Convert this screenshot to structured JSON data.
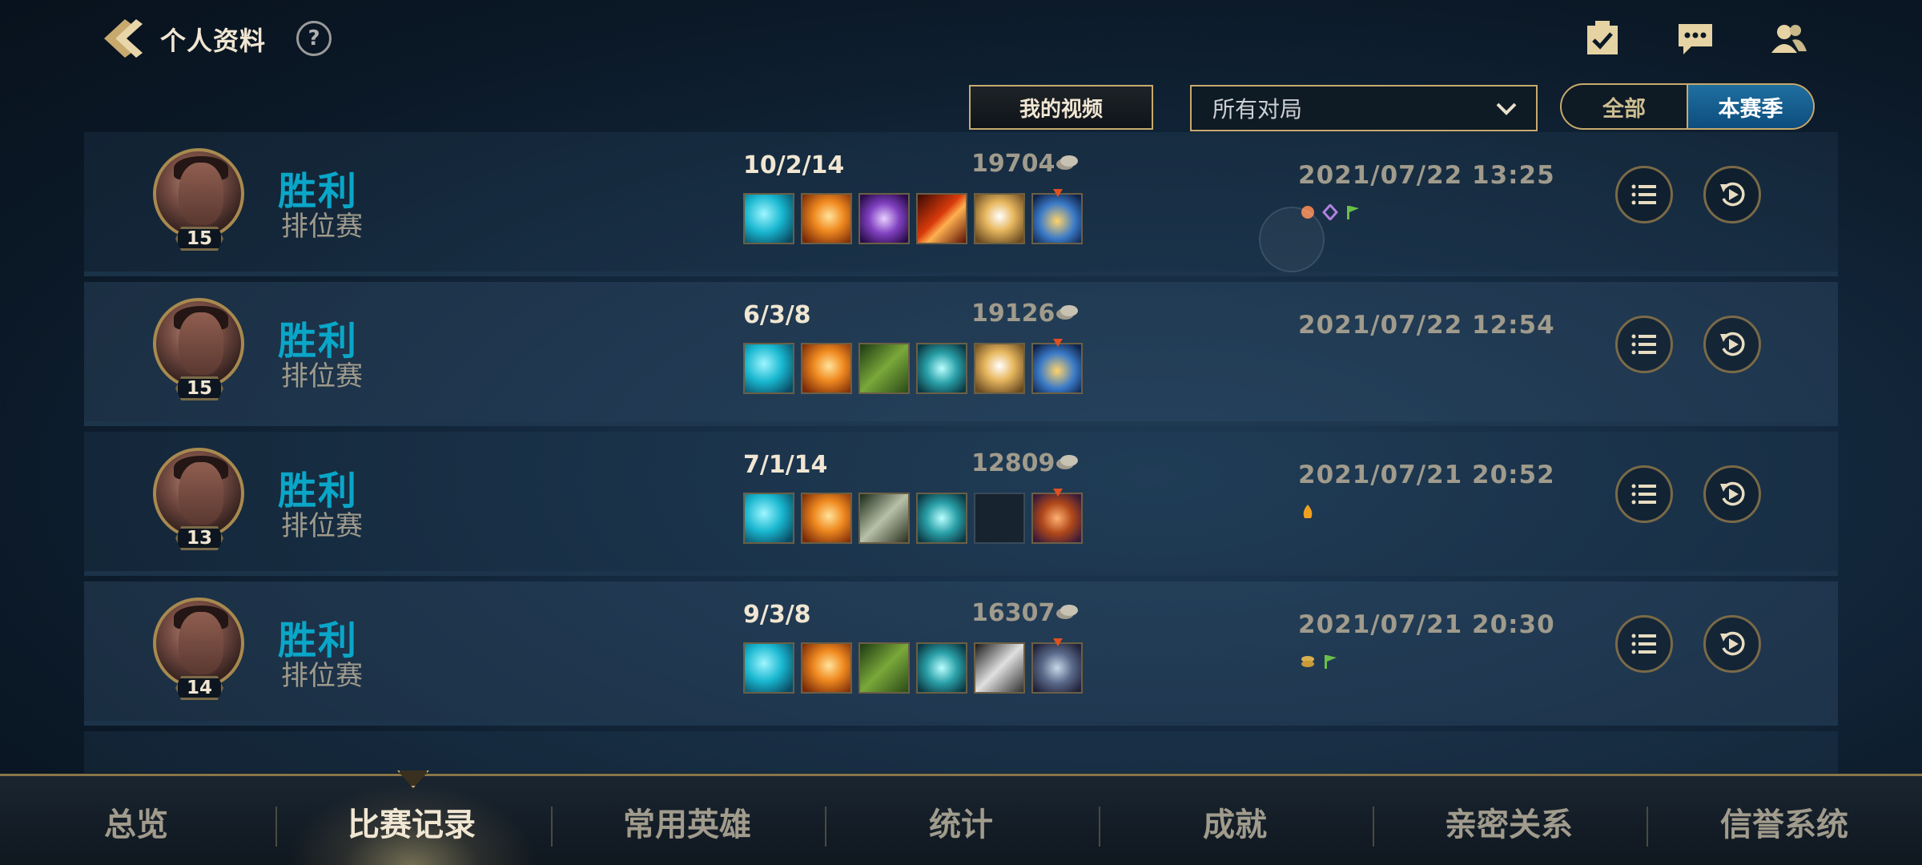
{
  "header": {
    "title": "个人资料",
    "help": "?"
  },
  "filters": {
    "my_videos": "我的视频",
    "match_filter": "所有对局",
    "season_all": "全部",
    "season_current": "本赛季"
  },
  "matches": [
    {
      "result": "胜利",
      "mode": "排位赛",
      "level": "15",
      "kda": "10/2/14",
      "gold": "19704",
      "datetime": "2021/07/22 13:25",
      "items": [
        "blue-blade",
        "sun-sword",
        "purple-gauntlet",
        "fire-blade",
        "golden-wings",
        "potion-elixir"
      ],
      "badges": [
        "fist-badge",
        "gem-badge",
        "flag-badge"
      ]
    },
    {
      "result": "胜利",
      "mode": "排位赛",
      "level": "15",
      "kda": "6/3/8",
      "gold": "19126",
      "datetime": "2021/07/22 12:54",
      "items": [
        "blue-blade",
        "sun-sword",
        "green-bow",
        "teal-claw",
        "golden-wings",
        "potion-elixir"
      ],
      "badges": []
    },
    {
      "result": "胜利",
      "mode": "排位赛",
      "level": "13",
      "kda": "7/1/14",
      "gold": "12809",
      "datetime": "2021/07/21 20:52",
      "items": [
        "blue-blade",
        "sun-sword",
        "green-sword",
        "teal-claw",
        "empty-slot",
        "imp-trinket"
      ],
      "badges": [
        "fire-badge"
      ]
    },
    {
      "result": "胜利",
      "mode": "排位赛",
      "level": "14",
      "kda": "9/3/8",
      "gold": "16307",
      "datetime": "2021/07/21 20:30",
      "items": [
        "blue-blade",
        "sun-sword",
        "green-bow",
        "teal-claw",
        "steel-sword",
        "bat-trinket"
      ],
      "badges": [
        "coins-badge",
        "flag-badge"
      ]
    }
  ],
  "nav": {
    "tabs": [
      "总览",
      "比赛记录",
      "常用英雄",
      "统计",
      "成就",
      "亲密关系",
      "信誉系统"
    ],
    "active": "比赛记录"
  },
  "colors": {
    "gold": "#c8aa6e",
    "victory": "#0aa6c8",
    "active_toggle": "#1f6fa0"
  }
}
